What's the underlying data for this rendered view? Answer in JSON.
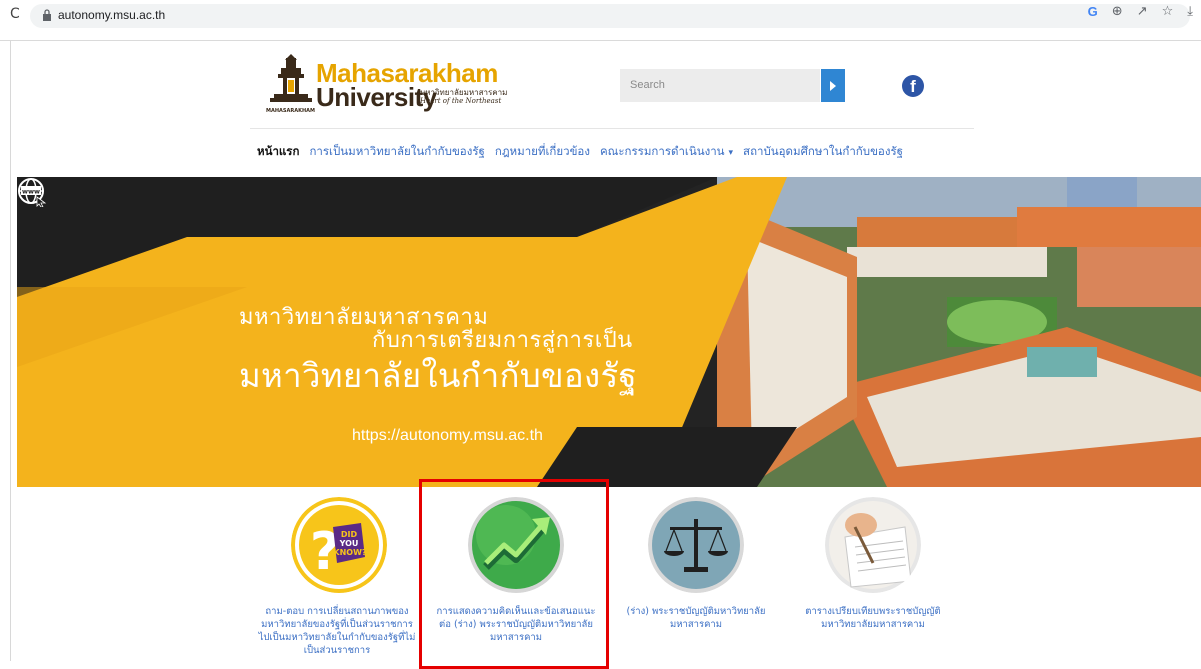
{
  "browser": {
    "url": "autonomy.msu.ac.th",
    "toolbar_icons": [
      "G",
      "⊕",
      "↗",
      "☆",
      "⤓"
    ]
  },
  "header": {
    "logo_line1": "Mahasarakham",
    "logo_line2": "University",
    "logo_sub_thai": "มหาวิทยาลัยมหาสารคาม",
    "logo_tagline": "Heart of the Northeast",
    "logo_under": "MAHASARAKHAM",
    "search_placeholder": "Search",
    "facebook_icon": "f"
  },
  "nav": {
    "items": [
      {
        "label": "หน้าแรก"
      },
      {
        "label": "การเป็นมหาวิทยาลัยในกำกับของรัฐ"
      },
      {
        "label": "กฎหมายที่เกี่ยวข้อง"
      },
      {
        "label": "คณะกรรมการดำเนินงาน"
      },
      {
        "label": "สถาบันอุดมศึกษาในกำกับของรัฐ"
      }
    ],
    "caret": "▾"
  },
  "banner": {
    "line1": "มหาวิทยาลัยมหาสารคาม",
    "line2": "กับการเตรียมการสู่การเป็น",
    "line3": "มหาวิทยาลัยในกำกับของรัฐ",
    "url": "https://autonomy.msu.ac.th",
    "globe_label": "www"
  },
  "cards": [
    {
      "title": "ถาม-ตอบ การเปลี่ยนสถานภาพของมหาวิทยาลัยของรัฐที่เป็นส่วนราชการไปเป็นมหาวิทยาลัยในกำกับของรัฐที่ไม่เป็นส่วนราชการ",
      "icon": "did-you-know-icon",
      "badge": [
        "DID",
        "YOU",
        "KNOW?"
      ]
    },
    {
      "title": "การแสดงความคิดเห็นและข้อเสนอแนะต่อ (ร่าง) พระราชบัญญัติมหาวิทยาลัยมหาสารคาม",
      "icon": "growth-chart-icon"
    },
    {
      "title": "(ร่าง) พระราชบัญญัติมหาวิทยาลัยมหาสารคาม",
      "icon": "scales-icon"
    },
    {
      "title": "ตารางเปรียบเทียบพระราชบัญญัติมหาวิทยาลัยมหาสารคาม",
      "icon": "document-signing-icon"
    }
  ],
  "colors": {
    "accent_yellow": "#f4b31c",
    "link_blue": "#3b6fc4",
    "highlight_red": "#e50000"
  }
}
